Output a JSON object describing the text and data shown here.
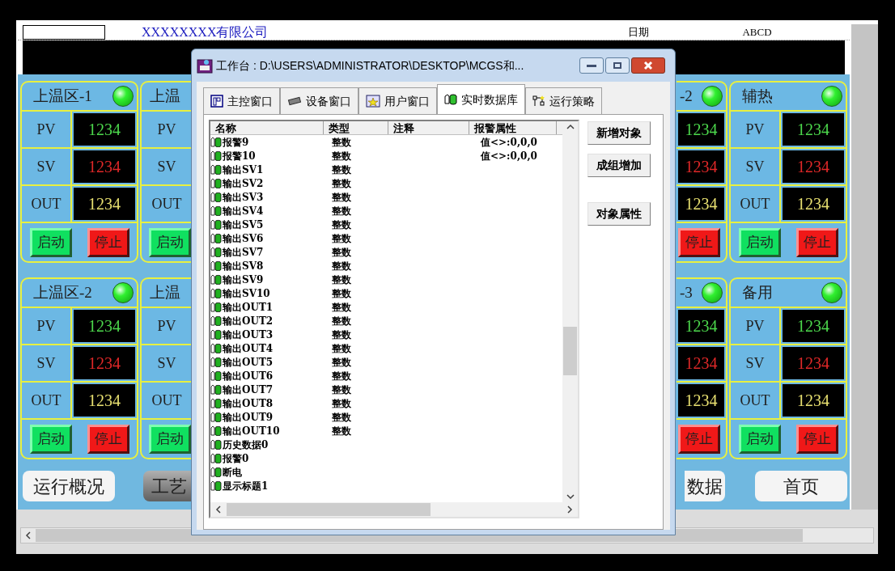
{
  "hmi": {
    "company": "XXXXXXXX有限公司",
    "date_label": "日期",
    "date_value": "ABCD",
    "panel_rows": [
      [
        {
          "kind": "full",
          "title": "上温区-1",
          "led_on": true,
          "rows": [
            {
              "kind": "pv",
              "label": "PV",
              "value": "1234"
            },
            {
              "kind": "sv",
              "label": "SV",
              "value": "1234"
            },
            {
              "kind": "out",
              "label": "OUT",
              "value": "1234"
            }
          ],
          "buttons": [
            {
              "kind": "start",
              "label": "启动"
            },
            {
              "kind": "stop",
              "label": "停止"
            }
          ]
        },
        {
          "kind": "left_part",
          "title": "上温",
          "rows": [
            {
              "label": "PV"
            },
            {
              "label": "SV"
            },
            {
              "label": "OUT"
            }
          ],
          "buttons": [
            {
              "kind": "start",
              "label": "启动"
            }
          ]
        },
        {
          "kind": "right_part",
          "title": "-2",
          "led_on": true,
          "rows": [
            {
              "kind": "pv",
              "value": "1234"
            },
            {
              "kind": "sv",
              "value": "1234"
            },
            {
              "kind": "out",
              "value": "1234"
            }
          ],
          "buttons": [
            {
              "kind": "stop",
              "label": "停止"
            }
          ]
        },
        {
          "kind": "full",
          "title": "辅热",
          "led_on": true,
          "rows": [
            {
              "kind": "pv",
              "label": "PV",
              "value": "1234"
            },
            {
              "kind": "sv",
              "label": "SV",
              "value": "1234"
            },
            {
              "kind": "out",
              "label": "OUT",
              "value": "1234"
            }
          ],
          "buttons": [
            {
              "kind": "start",
              "label": "启动"
            },
            {
              "kind": "stop",
              "label": "停止"
            }
          ]
        }
      ],
      [
        {
          "kind": "full",
          "title": "上温区-2",
          "led_on": true,
          "rows": [
            {
              "kind": "pv",
              "label": "PV",
              "value": "1234"
            },
            {
              "kind": "sv",
              "label": "SV",
              "value": "1234"
            },
            {
              "kind": "out",
              "label": "OUT",
              "value": "1234"
            }
          ],
          "buttons": [
            {
              "kind": "start",
              "label": "启动"
            },
            {
              "kind": "stop",
              "label": "停止"
            }
          ]
        },
        {
          "kind": "left_part",
          "title": "上温",
          "rows": [
            {
              "label": "PV"
            },
            {
              "label": "SV"
            },
            {
              "label": "OUT"
            }
          ],
          "buttons": [
            {
              "kind": "start",
              "label": "启动"
            }
          ]
        },
        {
          "kind": "right_part",
          "title": "-3",
          "led_on": true,
          "rows": [
            {
              "kind": "pv",
              "value": "1234"
            },
            {
              "kind": "sv",
              "value": "1234"
            },
            {
              "kind": "out",
              "value": "1234"
            }
          ],
          "buttons": [
            {
              "kind": "stop",
              "label": "停止"
            }
          ]
        },
        {
          "kind": "full",
          "title": "备用",
          "led_on": true,
          "rows": [
            {
              "kind": "pv",
              "label": "PV",
              "value": "1234"
            },
            {
              "kind": "sv",
              "label": "SV",
              "value": "1234"
            },
            {
              "kind": "out",
              "label": "OUT",
              "value": "1234"
            }
          ],
          "buttons": [
            {
              "kind": "start",
              "label": "启动"
            },
            {
              "kind": "stop",
              "label": "停止"
            }
          ]
        }
      ]
    ],
    "nav_buttons": [
      {
        "kind": "full",
        "label": "运行概况",
        "selected": false
      },
      {
        "kind": "left_part",
        "label": "工艺",
        "selected": true
      },
      {
        "kind": "right_part",
        "label": "数据",
        "selected": false
      },
      {
        "kind": "full",
        "label": "首页",
        "selected": false
      }
    ]
  },
  "dialog": {
    "title": "工作台 : D:\\USERS\\ADMINISTRATOR\\DESKTOP\\MCGS和...",
    "tabs": [
      {
        "label": "主控窗口",
        "kind": "main",
        "selected": false
      },
      {
        "label": "设备窗口",
        "kind": "device",
        "selected": false
      },
      {
        "label": "用户窗口",
        "kind": "user",
        "selected": false
      },
      {
        "label": "实时数据库",
        "kind": "database",
        "selected": true
      },
      {
        "label": "运行策略",
        "kind": "strategy",
        "selected": false
      }
    ],
    "table": {
      "columns": [
        "名称",
        "类型",
        "注释",
        "报警属性"
      ],
      "rows": [
        {
          "name": "报警9",
          "type": "整数",
          "alarm": "值<>:0,0,0"
        },
        {
          "name": "报警10",
          "type": "整数",
          "alarm": "值<>:0,0,0"
        },
        {
          "name": "输出SV1",
          "type": "整数"
        },
        {
          "name": "输出SV2",
          "type": "整数"
        },
        {
          "name": "输出SV3",
          "type": "整数"
        },
        {
          "name": "输出SV4",
          "type": "整数"
        },
        {
          "name": "输出SV5",
          "type": "整数"
        },
        {
          "name": "输出SV6",
          "type": "整数"
        },
        {
          "name": "输出SV7",
          "type": "整数"
        },
        {
          "name": "输出SV8",
          "type": "整数"
        },
        {
          "name": "输出SV9",
          "type": "整数"
        },
        {
          "name": "输出SV10",
          "type": "整数"
        },
        {
          "name": "输出OUT1",
          "type": "整数"
        },
        {
          "name": "输出OUT2",
          "type": "整数"
        },
        {
          "name": "输出OUT3",
          "type": "整数"
        },
        {
          "name": "输出OUT4",
          "type": "整数"
        },
        {
          "name": "输出OUT5",
          "type": "整数"
        },
        {
          "name": "输出OUT6",
          "type": "整数"
        },
        {
          "name": "输出OUT7",
          "type": "整数"
        },
        {
          "name": "输出OUT8",
          "type": "整数"
        },
        {
          "name": "输出OUT9",
          "type": "整数"
        },
        {
          "name": "输出OUT10",
          "type": "整数"
        },
        {
          "name": "历史数据0"
        },
        {
          "name": "报警0"
        },
        {
          "name": "断电"
        },
        {
          "name": "显示标题1"
        }
      ]
    },
    "buttons": [
      {
        "label": "新增对象"
      },
      {
        "label": "成组增加"
      },
      {
        "label": "对象属性"
      }
    ]
  }
}
